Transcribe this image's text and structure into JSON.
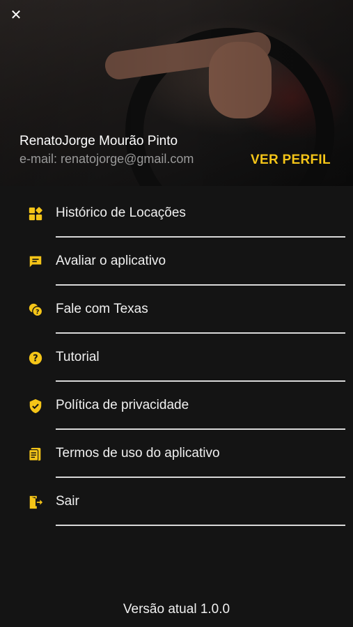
{
  "header": {
    "close_icon": "close-icon",
    "user_name": "RenatoJorge Mourão Pinto",
    "email_label": "e-mail:",
    "email": "renatojorge@gmail.com",
    "profile_link": "VER PERFIL",
    "accent_color": "#f5c518"
  },
  "menu": {
    "items": [
      {
        "label": "Histórico de Locações",
        "icon": "grid-icon"
      },
      {
        "label": "Avaliar o aplicativo",
        "icon": "feedback-icon"
      },
      {
        "label": "Fale com Texas",
        "icon": "chat-question-icon"
      },
      {
        "label": "Tutorial",
        "icon": "help-circle-icon"
      },
      {
        "label": "Política de privacidade",
        "icon": "shield-check-icon"
      },
      {
        "label": "Termos de uso do aplicativo",
        "icon": "document-icon"
      },
      {
        "label": "Sair",
        "icon": "exit-icon"
      }
    ]
  },
  "footer": {
    "version": "Versão atual 1.0.0"
  }
}
